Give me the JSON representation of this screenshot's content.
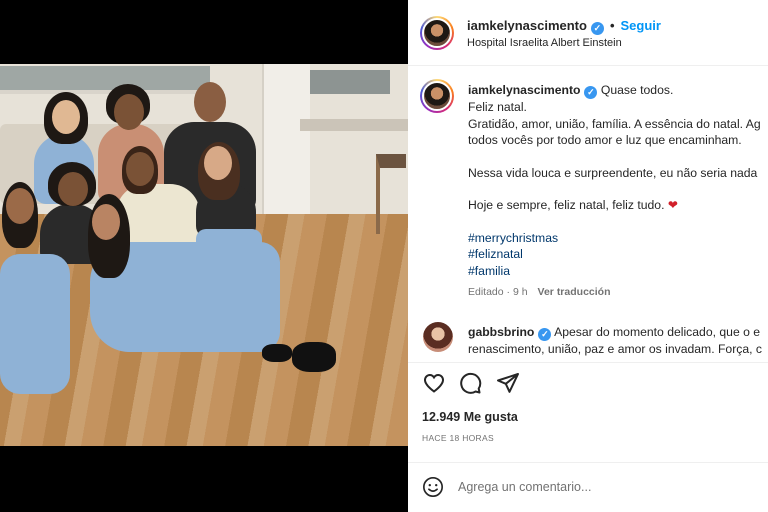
{
  "post": {
    "username": "iamkelynascimento",
    "follow_label": "Seguir",
    "location": "Hospital Israelita Albert Einstein"
  },
  "caption": {
    "username": "iamkelynascimento",
    "lines": [
      "Quase todos.",
      "Feliz natal.",
      "Gratidão, amor, união, família. A essência do natal. Ag",
      "todos vocês por todo amor e luz que encaminham.",
      "",
      "Nessa vida louca e surpreendente, eu não seria nada",
      "",
      "Hoje e sempre, feliz natal, feliz tudo. ❤",
      ""
    ],
    "hashtags": [
      "#merrychristmas",
      "#feliznatal",
      "#familia"
    ],
    "edited": "Editado · 9 h",
    "translate": "Ver traducción"
  },
  "comment": {
    "username": "gabbsbrino",
    "line1": "Apesar do momento delicado, que o e",
    "line2": "renascimento, união, paz e amor os invadam. Força, c"
  },
  "actions": {
    "like_icon": "heart-icon",
    "comment_icon": "comment-icon",
    "share_icon": "share-icon"
  },
  "likes": "12.949 Me gusta",
  "timestamp": "HACE 18 HORAS",
  "add_comment": {
    "placeholder": "Agrega un comentario...",
    "emoji_icon": "emoji-icon"
  },
  "colors": {
    "follow": "#0095f6",
    "verified": "#3897f0",
    "hashtag": "#00376b",
    "heart_emoji": "#d1202a"
  }
}
